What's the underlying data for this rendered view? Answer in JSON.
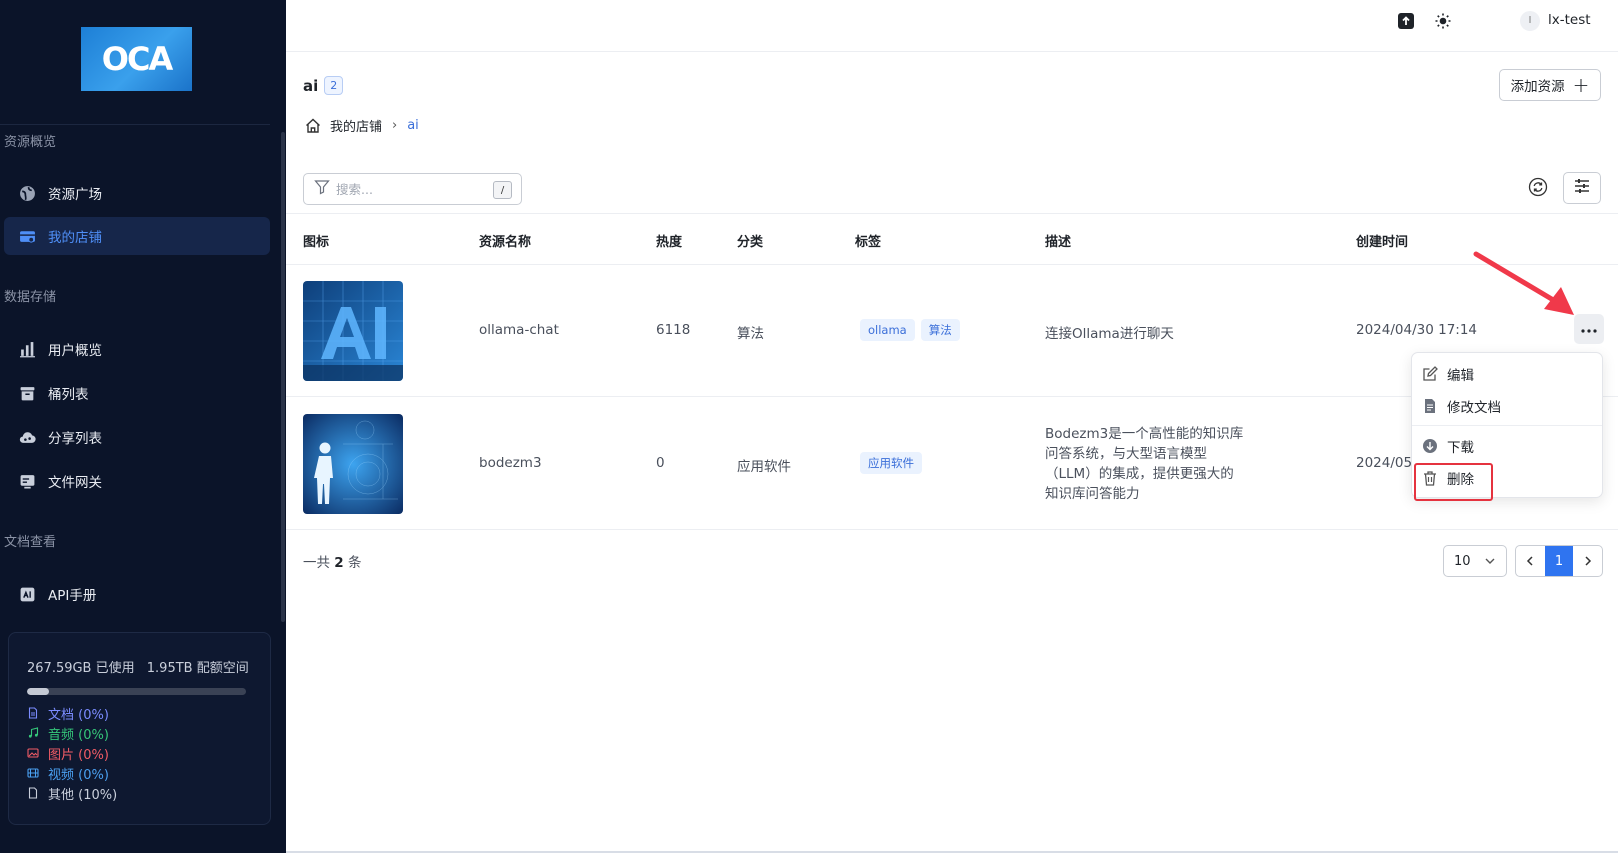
{
  "sidebar": {
    "logo_text": "OCA",
    "sections": {
      "overview": "资源概览",
      "storage": "数据存储",
      "docs": "文档查看"
    },
    "items": [
      {
        "label": "资源广场",
        "icon": "globe-icon"
      },
      {
        "label": "我的店铺",
        "icon": "store-icon",
        "active": true
      },
      {
        "label": "用户概览",
        "icon": "bar-chart-icon"
      },
      {
        "label": "桶列表",
        "icon": "bucket-icon"
      },
      {
        "label": "分享列表",
        "icon": "cloud-share-icon"
      },
      {
        "label": "文件网关",
        "icon": "gateway-icon"
      },
      {
        "label": "API手册",
        "icon": "api-book-icon"
      }
    ],
    "storage": {
      "used": "267.59GB 已使用",
      "quota": "1.95TB 配额空间",
      "used_fraction": 0.1,
      "legend": [
        {
          "label": "文档 (0%)",
          "color": "#7b8cff",
          "icon": "document-icon"
        },
        {
          "label": "音频 (0%)",
          "color": "#35c77a",
          "icon": "music-icon"
        },
        {
          "label": "图片 (0%)",
          "color": "#f25c66",
          "icon": "image-icon"
        },
        {
          "label": "视频 (0%)",
          "color": "#4aa0f0",
          "icon": "film-icon"
        },
        {
          "label": "其他 (10%)",
          "color": "#c9cfdb",
          "icon": "file-icon"
        }
      ]
    }
  },
  "topbar": {
    "avatar_initial": "l",
    "username": "lx-test"
  },
  "page": {
    "title": "ai",
    "count": "2",
    "add_button": "添加资源",
    "breadcrumb": {
      "home": "我的店铺",
      "current": "ai"
    },
    "search_placeholder": "搜索...",
    "search_shortcut": "/"
  },
  "table": {
    "headers": [
      "图标",
      "资源名称",
      "热度",
      "分类",
      "标签",
      "描述",
      "创建时间"
    ],
    "rows": [
      {
        "name": "ollama-chat",
        "heat": "6118",
        "category": "算法",
        "tags": [
          "ollama",
          "算法"
        ],
        "description": "连接Ollama进行聊天",
        "created": "2024/04/30 17:14"
      },
      {
        "name": "bodezm3",
        "heat": "0",
        "category": "应用软件",
        "tags": [
          "应用软件"
        ],
        "description": "Bodezm3是一个高性能的知识库问答系统，与大型语言模型（LLM）的集成，提供更强大的知识库问答能力",
        "created": "2024/05"
      }
    ]
  },
  "menu": {
    "items": [
      {
        "label": "编辑",
        "icon": "edit-icon"
      },
      {
        "label": "修改文档",
        "icon": "document-edit-icon"
      },
      {
        "label": "下载",
        "icon": "download-icon"
      },
      {
        "label": "删除",
        "icon": "trash-icon"
      }
    ]
  },
  "pagination": {
    "total_prefix": "一共",
    "total": "2",
    "total_suffix": "条",
    "page_size": "10",
    "current_page": "1"
  },
  "colors": {
    "sidebar_bg": "#0b1429",
    "accent": "#2f74f0",
    "highlight": "#e5333f"
  }
}
